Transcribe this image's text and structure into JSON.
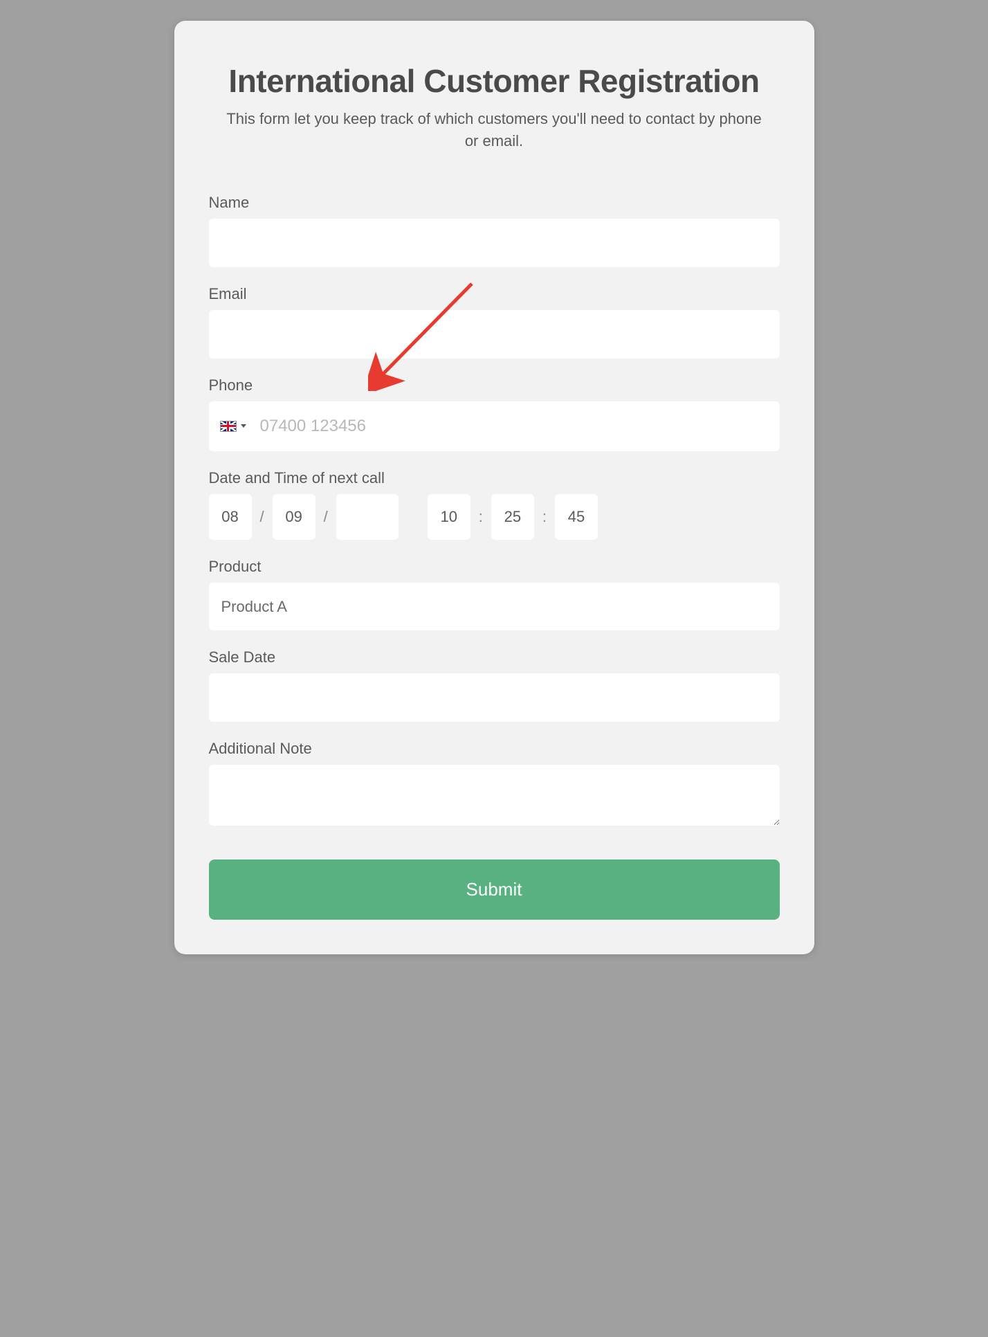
{
  "header": {
    "title": "International Customer Registration",
    "subtitle": "This form let you keep track of which customers you'll need to contact by phone or email."
  },
  "fields": {
    "name": {
      "label": "Name",
      "value": ""
    },
    "email": {
      "label": "Email",
      "value": ""
    },
    "phone": {
      "label": "Phone",
      "placeholder": "07400 123456",
      "value": "",
      "country": "GB"
    },
    "datetime": {
      "label": "Date and Time of next call",
      "day": "08",
      "month": "09",
      "year": "",
      "hour": "10",
      "minute": "25",
      "second": "45"
    },
    "product": {
      "label": "Product",
      "value": "Product A"
    },
    "sale_date": {
      "label": "Sale Date",
      "value": ""
    },
    "note": {
      "label": "Additional Note",
      "value": ""
    }
  },
  "submit": {
    "label": "Submit"
  },
  "colors": {
    "accent": "#57b181",
    "card": "#f2f2f2",
    "page_bg": "#a0a0a0",
    "arrow": "#e63b2e"
  }
}
